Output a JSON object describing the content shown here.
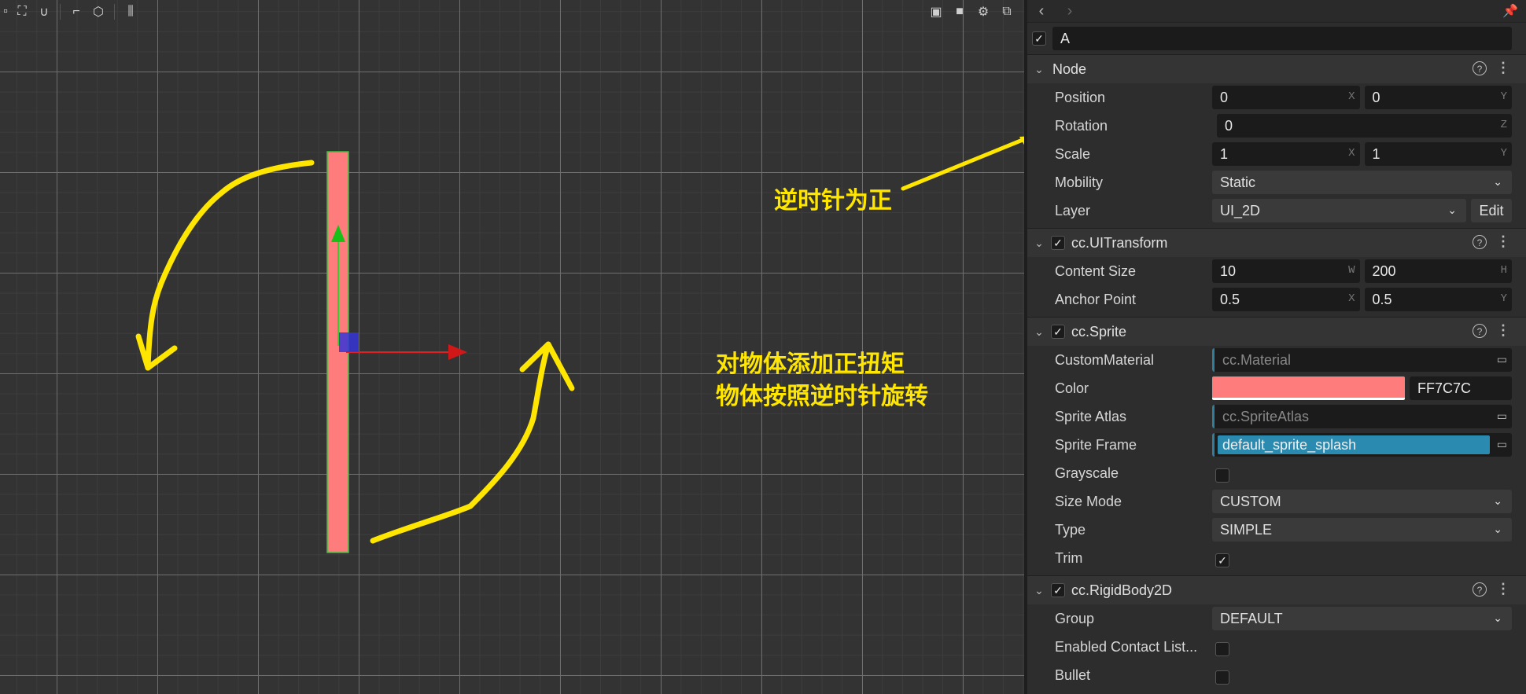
{
  "scene": {
    "annotations": {
      "ccw_positive": "逆时针为正",
      "torque_line1": "对物体添加正扭矩",
      "torque_line2": "物体按照逆时针旋转"
    },
    "sprite_color": "#ff7c7c",
    "annotation_color": "#ffe600"
  },
  "inspector": {
    "node_name": "A",
    "node_section": {
      "title": "Node",
      "position": {
        "label": "Position",
        "x": "0",
        "y": "0"
      },
      "rotation": {
        "label": "Rotation",
        "z": "0"
      },
      "scale": {
        "label": "Scale",
        "x": "1",
        "y": "1"
      },
      "mobility": {
        "label": "Mobility",
        "value": "Static"
      },
      "layer": {
        "label": "Layer",
        "value": "UI_2D",
        "edit": "Edit"
      }
    },
    "uitransform": {
      "title": "cc.UITransform",
      "content_size": {
        "label": "Content Size",
        "w": "10",
        "h": "200"
      },
      "anchor_point": {
        "label": "Anchor Point",
        "x": "0.5",
        "y": "0.5"
      }
    },
    "sprite": {
      "title": "cc.Sprite",
      "custom_material": {
        "label": "CustomMaterial",
        "placeholder": "cc.Material"
      },
      "color": {
        "label": "Color",
        "hex": "FF7C7C"
      },
      "sprite_atlas": {
        "label": "Sprite Atlas",
        "placeholder": "cc.SpriteAtlas"
      },
      "sprite_frame": {
        "label": "Sprite Frame",
        "value": "default_sprite_splash"
      },
      "grayscale": {
        "label": "Grayscale",
        "checked": false
      },
      "size_mode": {
        "label": "Size Mode",
        "value": "CUSTOM"
      },
      "type": {
        "label": "Type",
        "value": "SIMPLE"
      },
      "trim": {
        "label": "Trim",
        "checked": true
      }
    },
    "rigidbody": {
      "title": "cc.RigidBody2D",
      "group": {
        "label": "Group",
        "value": "DEFAULT"
      },
      "enabled_contact": {
        "label": "Enabled Contact List...",
        "checked": false
      },
      "bullet": {
        "label": "Bullet"
      }
    },
    "axis_labels": {
      "x": "X",
      "y": "Y",
      "z": "Z",
      "w": "W",
      "h": "H"
    }
  }
}
